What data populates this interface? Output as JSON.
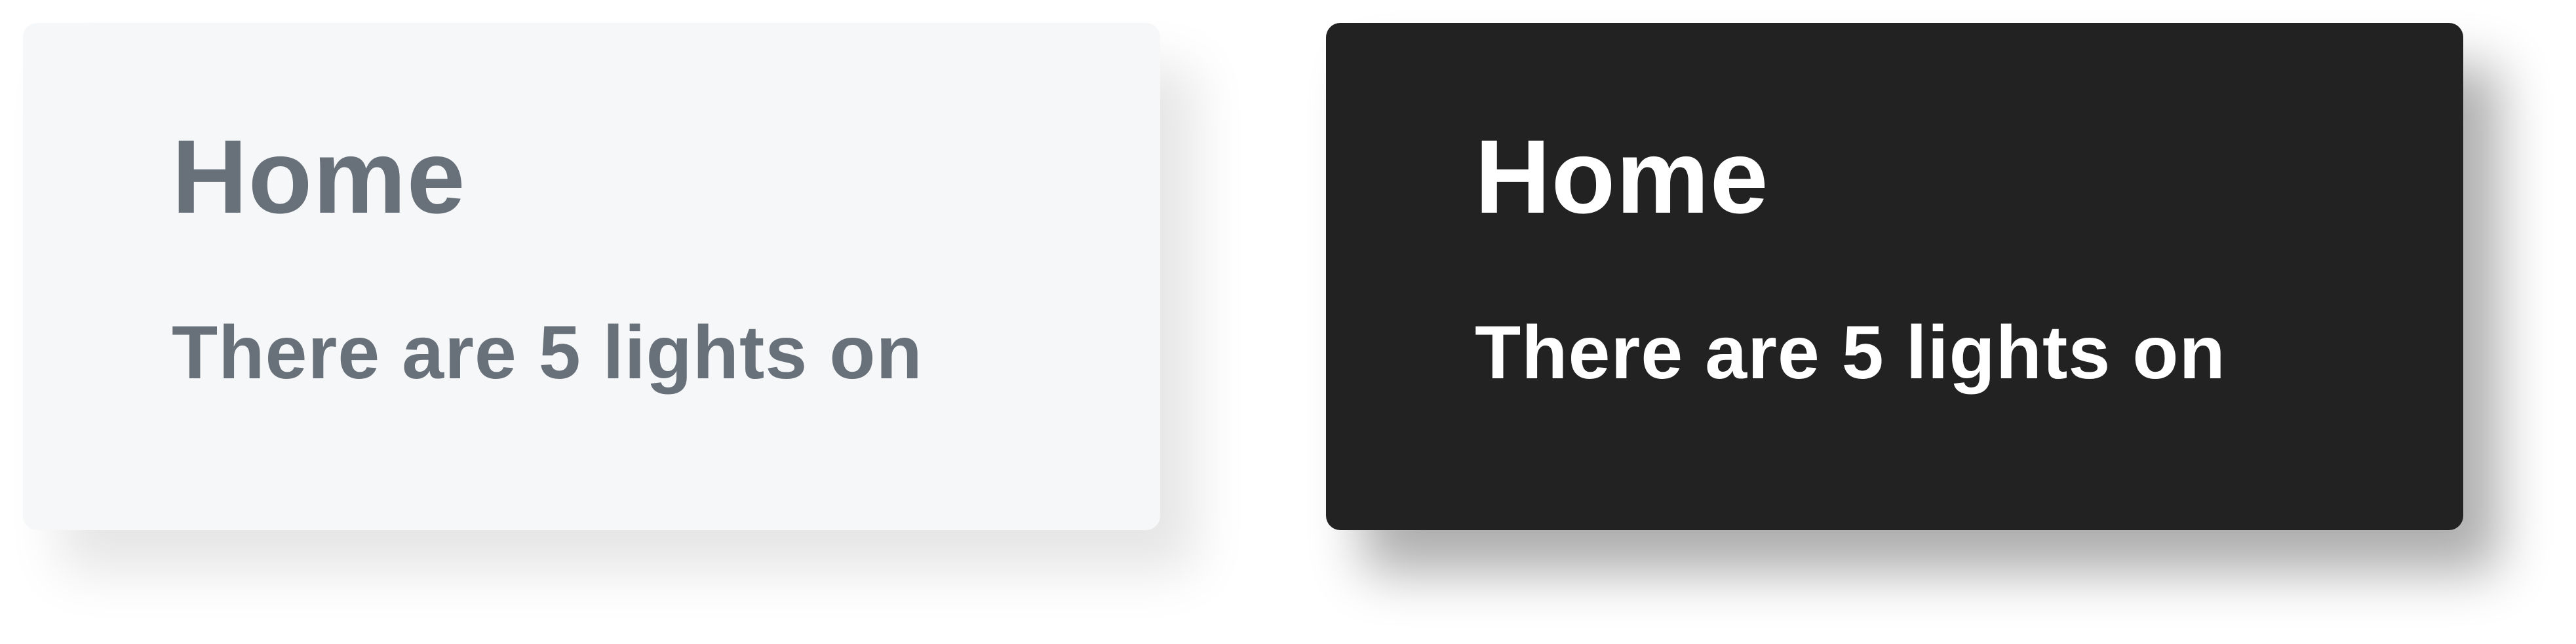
{
  "cards": [
    {
      "theme": "light",
      "title": "Home",
      "subtitle": "There are 5 lights on",
      "background": "#f6f7f9",
      "text_color": "#687079"
    },
    {
      "theme": "dark",
      "title": "Home",
      "subtitle": "There are 5 lights on",
      "background": "#222222",
      "text_color": "#ffffff"
    }
  ]
}
